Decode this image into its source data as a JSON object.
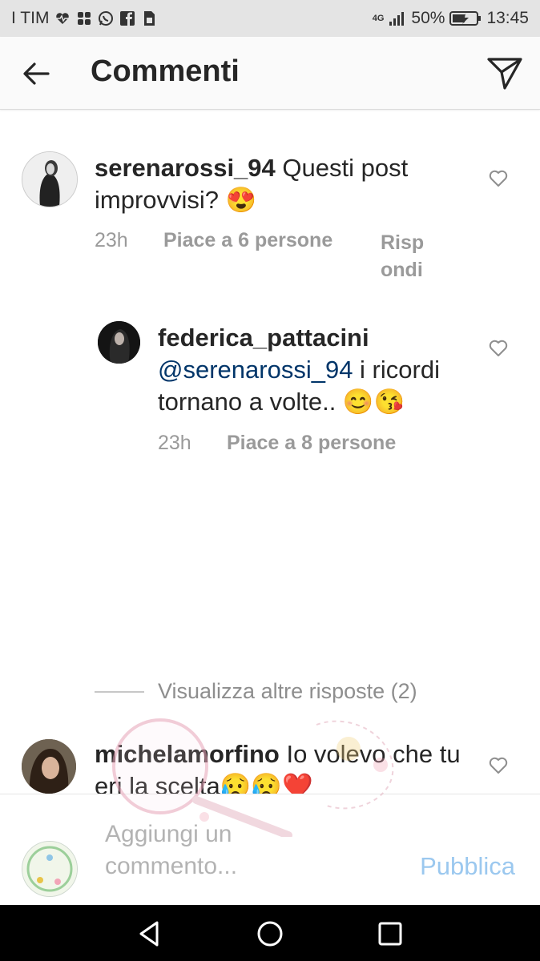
{
  "status_bar": {
    "carrier": "I TIM",
    "network": "4G",
    "battery": "50%",
    "time": "13:45"
  },
  "header": {
    "title": "Commenti"
  },
  "comments": [
    {
      "username": "serenarossi_94",
      "text": "Questi post improvvisi? 😍",
      "time": "23h",
      "likes": "Piace a 6 persone",
      "reply": "Risp ondi"
    },
    {
      "username": "federica_pattacini",
      "mention": "@serenarossi_94",
      "text": " i ricordi tornano a volte.. 😊😘",
      "time": "23h",
      "likes": "Piace a 8 persone"
    },
    {
      "username": "michelamorfino",
      "text": "Io volevo che tu eri la scelta😥😥❤️"
    }
  ],
  "view_more": "Visualizza altre risposte (2)",
  "composer": {
    "placeholder": "Aggiungi un commento...",
    "publish": "Pubblica"
  },
  "icons": [
    "back-arrow-icon",
    "send-icon",
    "heart-icon",
    "back-nav-icon",
    "home-nav-icon",
    "recents-nav-icon"
  ],
  "colors": {
    "mention": "#003569",
    "publish_disabled": "#9bc8ef",
    "meta": "#9a9a9a"
  }
}
